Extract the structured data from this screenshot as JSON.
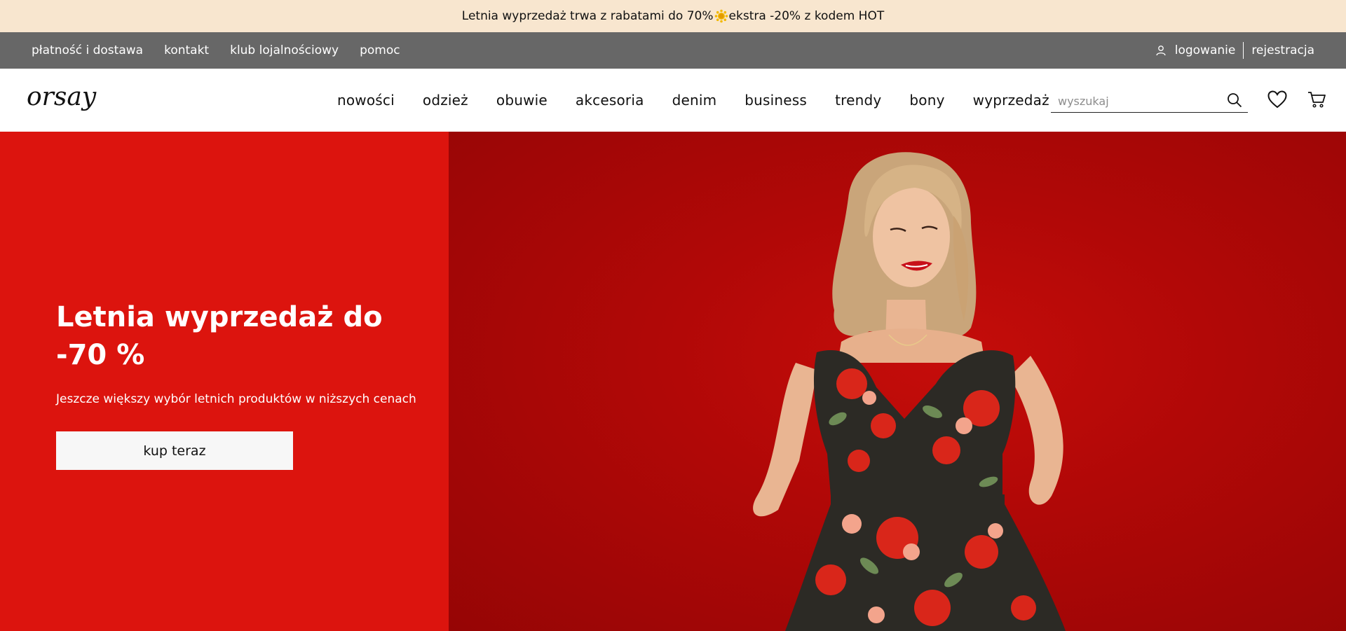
{
  "promo": {
    "text_before": "Letnia wyprzedaż trwa z rabatami do 70%",
    "icon": "sun-icon",
    "text_after": "ekstra -20% z kodem HOT"
  },
  "utility_nav": {
    "links": [
      "płatność i dostawa",
      "kontakt",
      "klub lojalnościowy",
      "pomoc"
    ],
    "login_label": "logowanie",
    "register_label": "rejestracja"
  },
  "header": {
    "logo_text": "orsay",
    "nav": [
      "nowości",
      "odzież",
      "obuwie",
      "akcesoria",
      "denim",
      "business",
      "trendy",
      "bony",
      "wyprzedaż"
    ],
    "search_placeholder": "wyszukaj",
    "icons": [
      "search-icon",
      "heart-icon",
      "cart-icon"
    ]
  },
  "hero": {
    "title": "Letnia wyprzedaż do -70 %",
    "subtitle": "Jeszcze większy wybór letnich produktów w niższych cenach",
    "cta_label": "kup teraz",
    "left_panel_color": "#dc140e",
    "photo_description_color": "#b10807"
  },
  "colors": {
    "promo_bg": "#f8e6cf",
    "utility_bg": "#676767",
    "hero_red": "#dc140e"
  }
}
